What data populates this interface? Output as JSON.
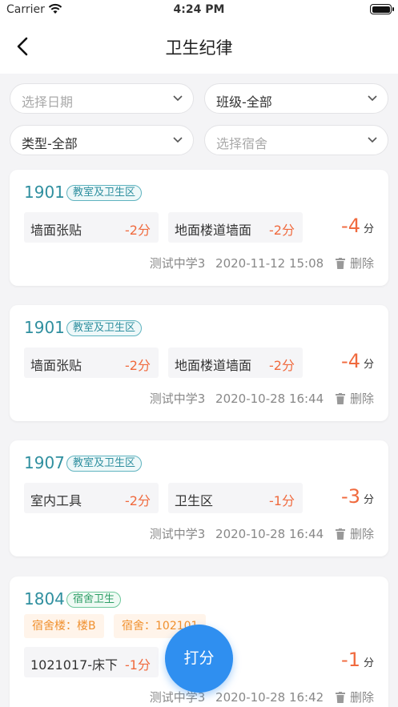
{
  "status": {
    "carrier": "Carrier",
    "time": "4:24 PM"
  },
  "nav": {
    "title": "卫生纪律"
  },
  "filters": [
    {
      "label": "选择日期",
      "placeholder": true
    },
    {
      "label": "班级-全部",
      "placeholder": false
    },
    {
      "label": "类型-全部",
      "placeholder": false
    },
    {
      "label": "选择宿舍",
      "placeholder": true
    }
  ],
  "cards": [
    {
      "class_no": "1901",
      "tag": "教室及卫生区",
      "items": [
        {
          "name": "墙面张贴",
          "score": "-2分"
        },
        {
          "name": "地面楼道墙面",
          "score": "-2分"
        }
      ],
      "total": "-4",
      "unit": "分",
      "school": "测试中学3",
      "datetime": "2020-11-12 15:08",
      "delete": "删除"
    },
    {
      "class_no": "1901",
      "tag": "教室及卫生区",
      "items": [
        {
          "name": "墙面张贴",
          "score": "-2分"
        },
        {
          "name": "地面楼道墙面",
          "score": "-2分"
        }
      ],
      "total": "-4",
      "unit": "分",
      "school": "测试中学3",
      "datetime": "2020-10-28 16:44",
      "delete": "删除"
    },
    {
      "class_no": "1907",
      "tag": "教室及卫生区",
      "items": [
        {
          "name": "室内工具",
          "score": "-2分"
        },
        {
          "name": "卫生区",
          "score": "-1分"
        }
      ],
      "total": "-3",
      "unit": "分",
      "school": "测试中学3",
      "datetime": "2020-10-28 16:44",
      "delete": "删除"
    },
    {
      "class_no": "1804",
      "tag": "宿舍卫生",
      "dorm_building": "宿舍楼：楼B",
      "dorm_room": "宿舍：102101",
      "items": [
        {
          "name": "1021017-床下",
          "score": "-1分"
        }
      ],
      "total": "-1",
      "unit": "分",
      "school": "测试中学3",
      "datetime": "2020-10-28 16:42",
      "delete": "删除"
    }
  ],
  "fab": {
    "label": "打分"
  },
  "colors": {
    "accent": "#2f8ff0",
    "teal": "#2f8f9f",
    "deduction": "#f06a3e"
  }
}
